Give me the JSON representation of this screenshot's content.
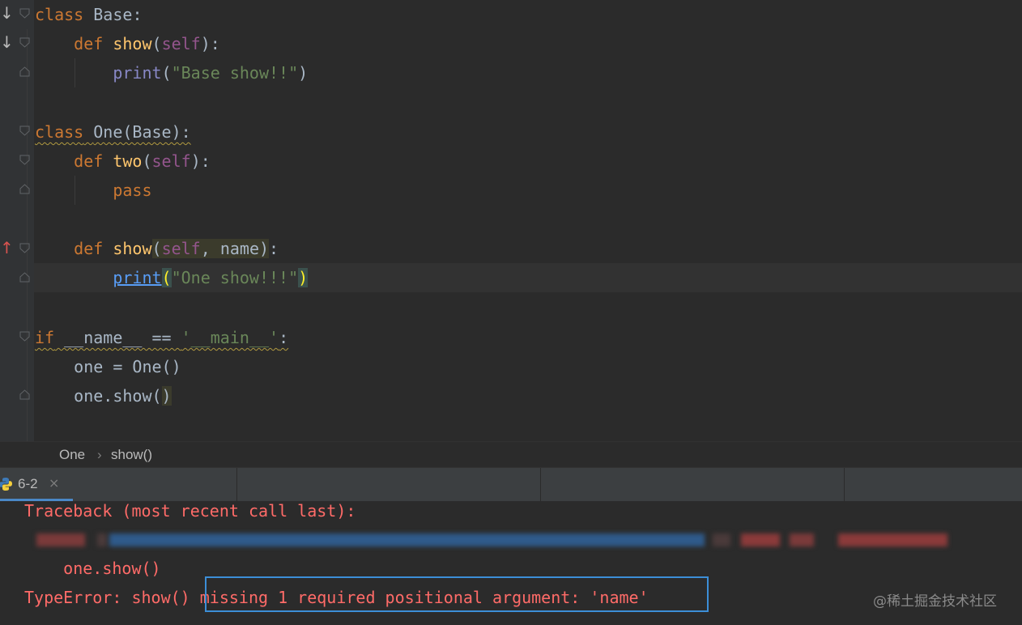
{
  "editor": {
    "lines": {
      "l1": {
        "kw": "class",
        "name": "Base",
        "rest": ":"
      },
      "l2": {
        "kw": "def",
        "name": "show",
        "open": "(",
        "self": "self",
        "close": "):"
      },
      "l3": {
        "bi": "print",
        "open": "(",
        "str": "\"Base show!!\"",
        "close": ")"
      },
      "l4": {
        "kw": "class",
        "name": "One(Base):"
      },
      "l5": {
        "kw": "def",
        "name": "two",
        "open": "(",
        "self": "self",
        "close": "):"
      },
      "l6": {
        "kw": "pass"
      },
      "l7": {
        "kw": "def",
        "name": "show",
        "open": "(",
        "self": "self",
        "comma": ", name",
        "close": ")",
        "colon": ":"
      },
      "l8": {
        "bi": "print",
        "open": "(",
        "str": "\"One show!!!\"",
        "close": ")"
      },
      "l9": {
        "kw": "if",
        "cond": " __name__ == ",
        "str": "'__main__'",
        "colon": ":"
      },
      "l10": {
        "text": "one = One()"
      },
      "l11": {
        "text": "one.show(",
        "close": ")"
      }
    }
  },
  "breadcrumb": {
    "class": "One",
    "sep": "›",
    "method": "show()"
  },
  "run_tab": {
    "label": "6-2",
    "close": "×"
  },
  "console": {
    "traceback": "Traceback (most recent call last):",
    "call": "    one.show()",
    "error_prefix": "TypeError: show() ",
    "error_msg": "missing 1 required positional argument: 'name'"
  },
  "watermark": "@稀土掘金技术社区",
  "colors": {
    "keyword": "#cc7832",
    "function": "#ffc66d",
    "self": "#94558d",
    "string": "#6a8759",
    "error": "#ff6b68",
    "highlight_box": "#3c8ed7"
  }
}
